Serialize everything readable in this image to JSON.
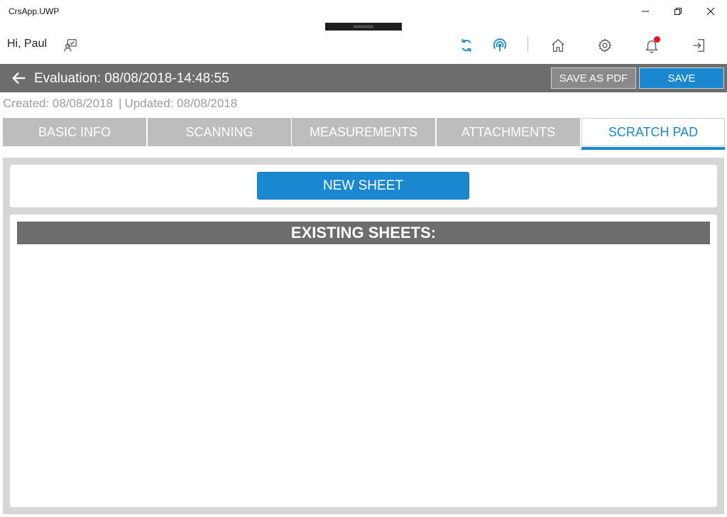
{
  "window": {
    "title": "CrsApp.UWP"
  },
  "header": {
    "greeting": "Hi, Paul",
    "icons": [
      "feedback-icon",
      "sync-icon",
      "signal-icon",
      "home-icon",
      "gear-icon",
      "bell-icon",
      "logout-icon"
    ],
    "has_notification": true
  },
  "evaluation": {
    "title": "Evaluation: 08/08/2018-14:48:55",
    "save_as_pdf_label": "SAVE AS PDF",
    "save_label": "SAVE",
    "created": "Created: 08/08/2018",
    "separator": "|",
    "updated": "Updated: 08/08/2018"
  },
  "tabs": [
    {
      "label": "BASIC INFO",
      "active": false
    },
    {
      "label": "SCANNING",
      "active": false
    },
    {
      "label": "MEASUREMENTS",
      "active": false
    },
    {
      "label": "ATTACHMENTS",
      "active": false
    },
    {
      "label": "SCRATCH PAD",
      "active": true
    }
  ],
  "scratch_pad": {
    "new_sheet_label": "NEW SHEET",
    "existing_sheets_heading": "EXISTING SHEETS:"
  },
  "colors": {
    "accent": "#1a88d0",
    "bar_gray": "#6d6d6d",
    "tab_inactive": "#bdbdbd",
    "notification": "#e81123"
  }
}
